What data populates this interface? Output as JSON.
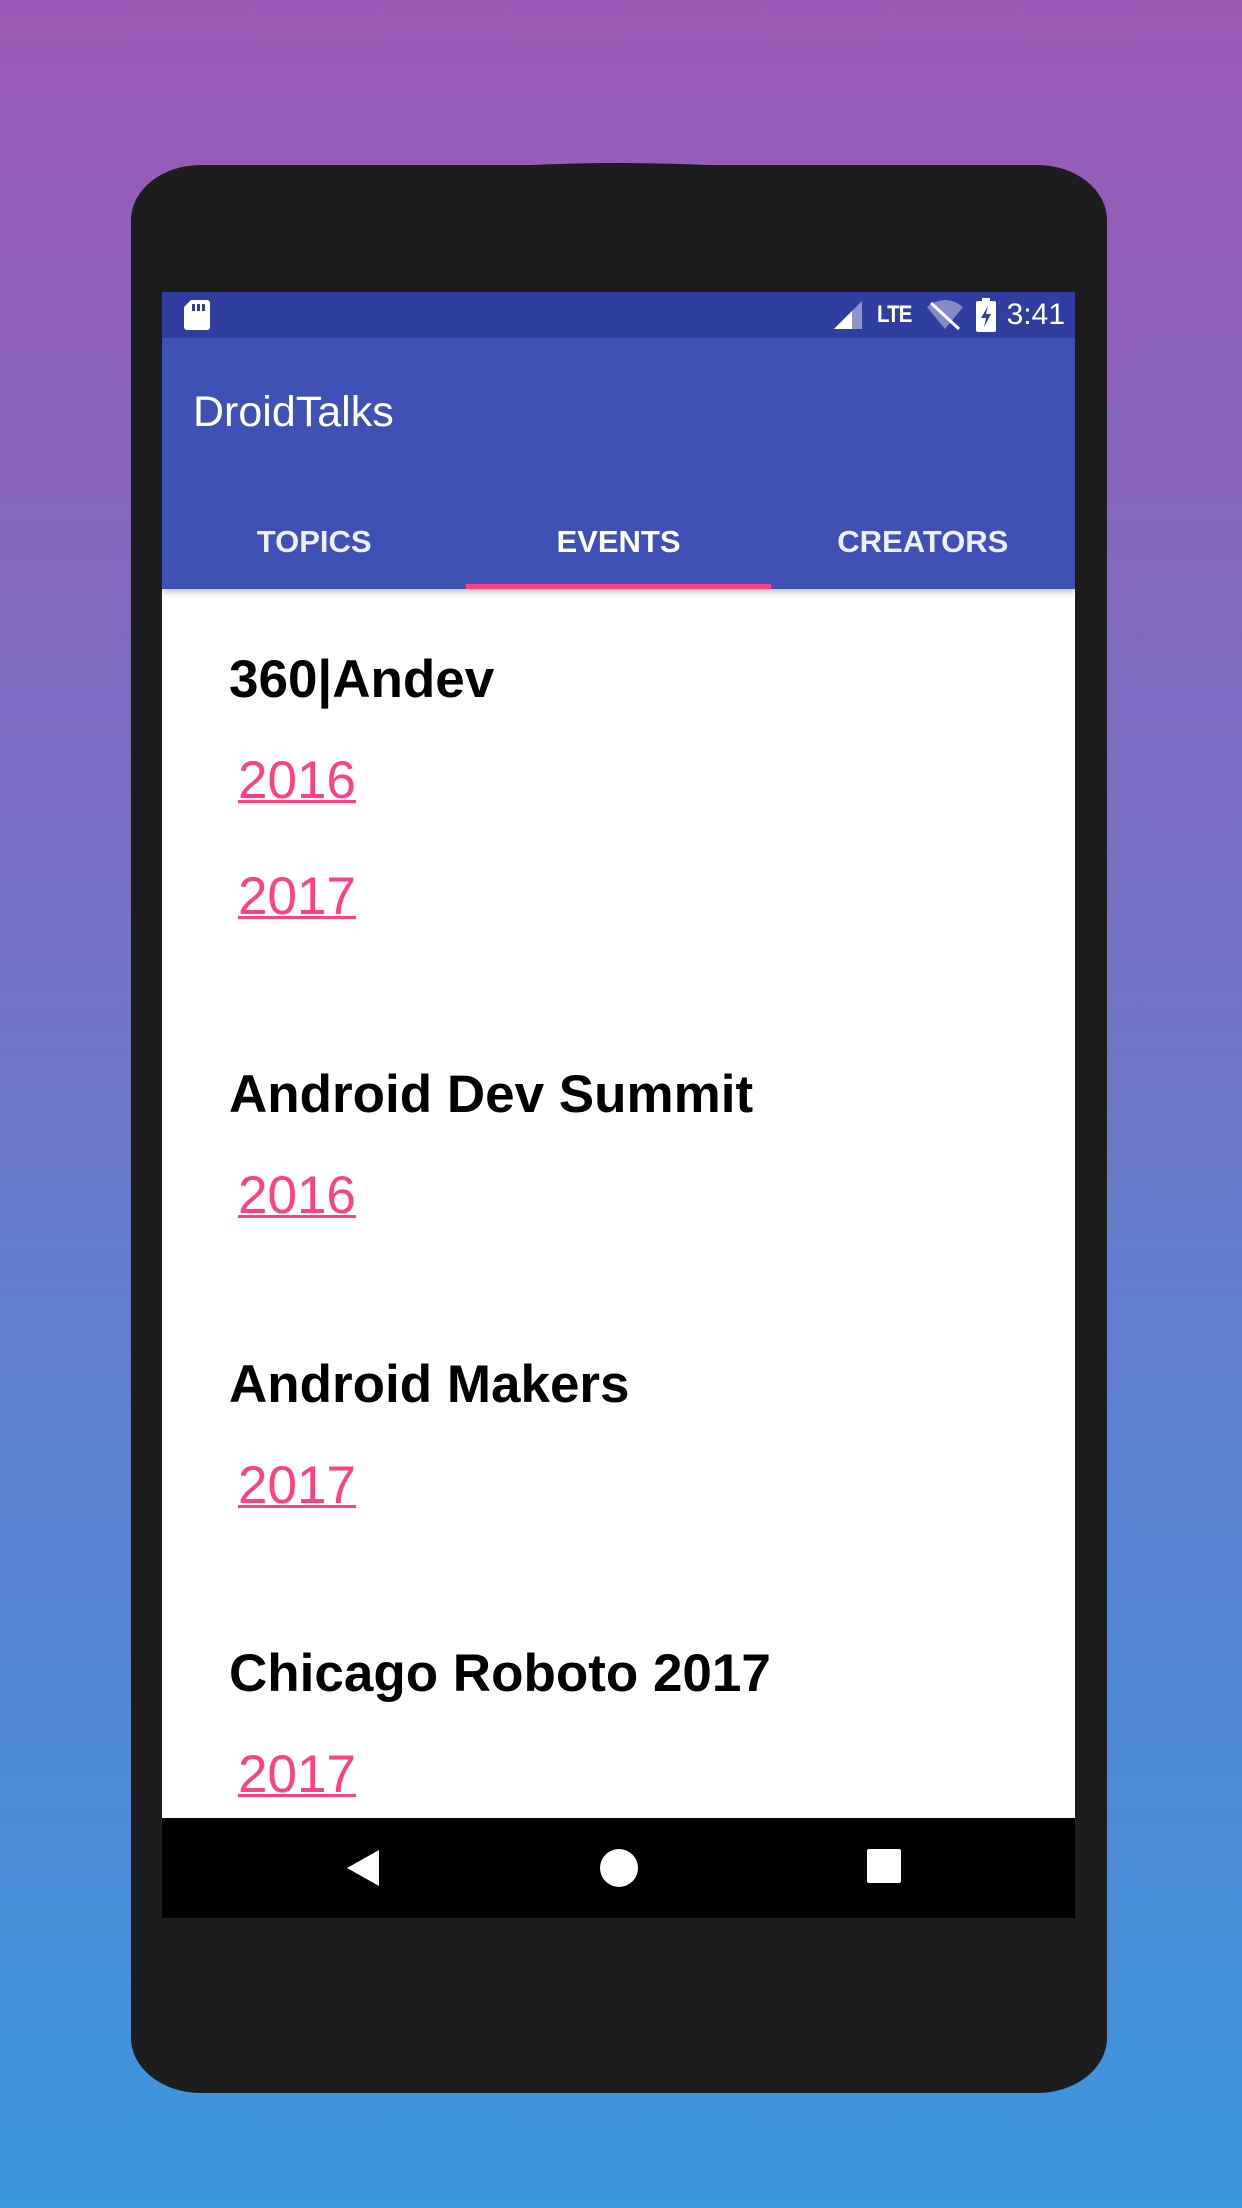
{
  "statusbar": {
    "time": "3:41",
    "network": "LTE"
  },
  "app": {
    "title": "DroidTalks"
  },
  "tabs": [
    {
      "label": "TOPICS",
      "selected": false
    },
    {
      "label": "EVENTS",
      "selected": true
    },
    {
      "label": "CREATORS",
      "selected": false
    }
  ],
  "events": [
    {
      "name": "360|Andev",
      "years": [
        "2016",
        "2017"
      ]
    },
    {
      "name": "Android Dev Summit",
      "years": [
        "2016"
      ]
    },
    {
      "name": "Android Makers",
      "years": [
        "2017"
      ]
    },
    {
      "name": "Chicago Roboto 2017",
      "years": [
        "2017"
      ]
    }
  ],
  "colors": {
    "primary": "#3f51b5",
    "primary_dark": "#303f9f",
    "accent": "#ff4081"
  },
  "icons": [
    "sd-card-icon",
    "signal-icon",
    "wifi-off-icon",
    "battery-charging-icon",
    "back-icon",
    "home-icon",
    "recents-icon"
  ]
}
